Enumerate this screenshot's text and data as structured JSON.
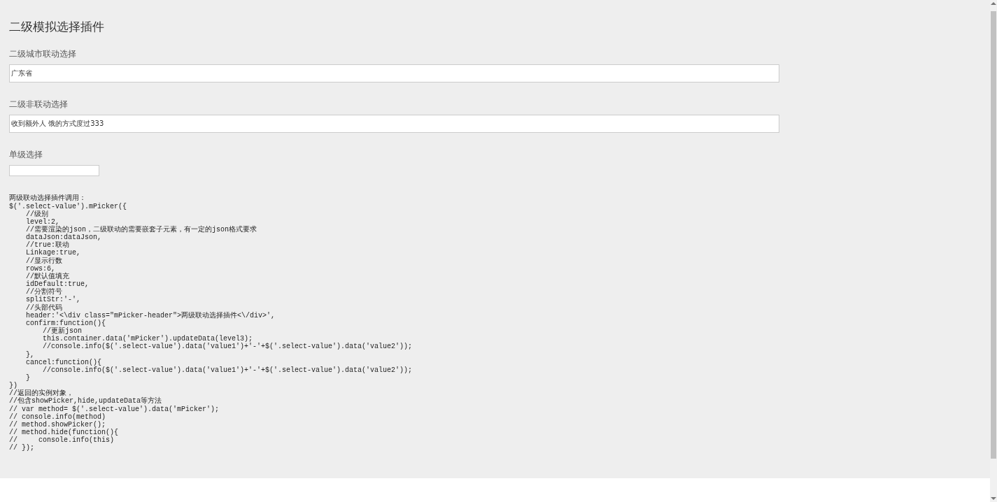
{
  "title": "二级模拟选择插件",
  "fields": [
    {
      "label": "二级城市联动选择",
      "value": "广东省",
      "kind": "wide"
    },
    {
      "label": "二级非联动选择",
      "value": "收到额外人 饿的方式度过333",
      "kind": "wide"
    },
    {
      "label": "单级选择",
      "kind": "short"
    }
  ],
  "code_lines": [
    "两级联动选择插件调用：",
    "$('.select-value').mPicker({",
    "    //级别",
    "    level:2,",
    "    //需要渲染的json，二级联动的需要嵌套子元素，有一定的json格式要求",
    "    dataJson:dataJson,",
    "    //true:联动",
    "    Linkage:true,",
    "    //显示行数",
    "    rows:6,",
    "    //默认值填充",
    "    idDefault:true,",
    "    //分割符号",
    "    splitStr:'-',",
    "    //头部代码",
    "    header:'<\\div class=\"mPicker-header\">两级联动选择插件<\\/div>',",
    "    confirm:function(){",
    "        //更新json",
    "        this.container.data('mPicker').updateData(level3);",
    "        //console.info($('.select-value').data('value1')+'-'+$('.select-value').data('value2'));",
    "    },",
    "    cancel:function(){",
    "        //console.info($('.select-value').data('value1')+'-'+$('.select-value').data('value2'));",
    "    }",
    "})",
    "//返回的实例对象，",
    "//包含showPicker,hide,updateData等方法",
    "// var method= $('.select-value').data('mPicker');",
    "// console.info(method)",
    "// method.showPicker();",
    "// method.hide(function(){",
    "//     console.info(this)",
    "// });"
  ]
}
